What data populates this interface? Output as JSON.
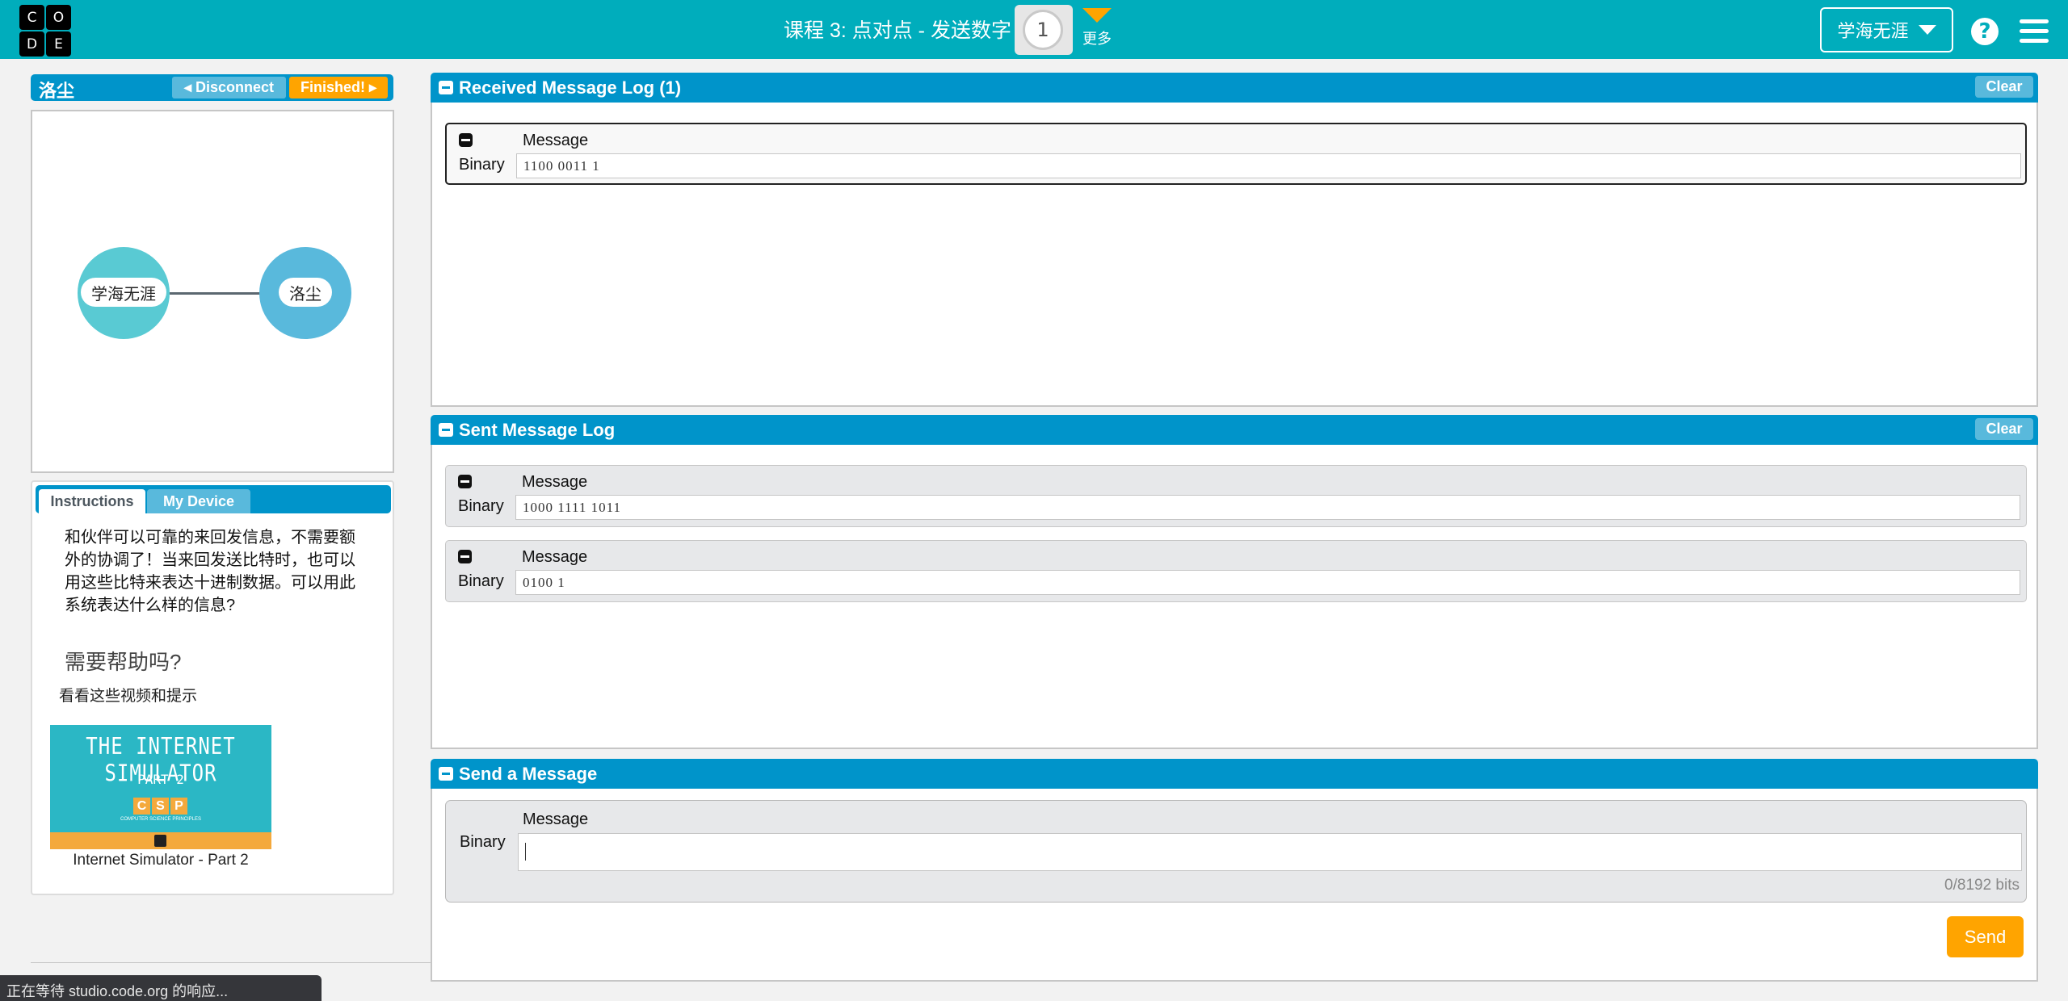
{
  "header": {
    "logo_letters": [
      "C",
      "O",
      "D",
      "E"
    ],
    "lesson_title": "课程 3: 点对点 - 发送数字",
    "level_number": "1",
    "more_label": "更多",
    "user_name": "学海无涯",
    "help_icon": "question-circle-icon",
    "menu_icon": "hamburger-menu-icon"
  },
  "node_panel": {
    "node_name": "洛尘",
    "disconnect_label": "Disconnect",
    "finished_label": "Finished!"
  },
  "network": {
    "left_node": "学海无涯",
    "right_node": "洛尘",
    "colors": {
      "left": "#59cad3",
      "right": "#59b9dc",
      "link": "#5b6770"
    }
  },
  "instructions": {
    "tabs": [
      {
        "label": "Instructions",
        "active": true
      },
      {
        "label": "My Device",
        "active": false
      }
    ],
    "text": "和伙伴可以可靠的来回发信息，不需要额外的协调了！当来回发送比特时，也可以用这些比特来表达十进制数据。可以用此系统表达什么样的信息?",
    "help_title": "需要帮助吗?",
    "help_subtitle": "看看这些视频和提示",
    "video": {
      "thumb_title": "THE INTERNET SIMULATOR",
      "thumb_part": "PART 2",
      "thumb_badge": [
        "C",
        "S",
        "P"
      ],
      "thumb_badge_sub": "COMPUTER SCIENCE PRINCIPLES",
      "caption": "Internet Simulator - Part 2"
    }
  },
  "received_log": {
    "title": "Received Message Log (1)",
    "clear_label": "Clear",
    "messages": [
      {
        "column_label": "Message",
        "encoding": "Binary",
        "value": "1100 0011 1"
      }
    ]
  },
  "sent_log": {
    "title": "Sent Message Log",
    "clear_label": "Clear",
    "messages": [
      {
        "column_label": "Message",
        "encoding": "Binary",
        "value": "1000 1111 1011"
      },
      {
        "column_label": "Message",
        "encoding": "Binary",
        "value": "0100 1"
      }
    ]
  },
  "send_panel": {
    "title": "Send a Message",
    "column_label": "Message",
    "encoding": "Binary",
    "input_value": "",
    "bit_count": "0/8192 bits",
    "send_label": "Send"
  },
  "status_bar": {
    "text": "正在等待 studio.code.org 的响应..."
  },
  "colors": {
    "topbar": "#00adbc",
    "panel_header": "#0094ca",
    "secondary_button": "#59b9dc",
    "accent_orange": "#ffa400"
  }
}
